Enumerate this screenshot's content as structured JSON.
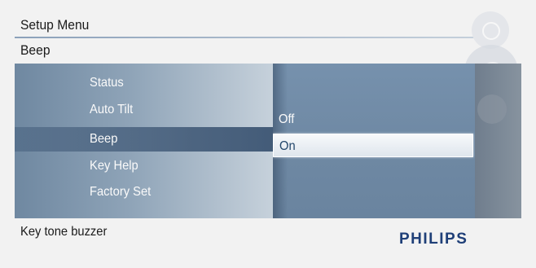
{
  "header": {
    "title": "Setup Menu",
    "breadcrumb": "Beep"
  },
  "menu": {
    "items": [
      {
        "label": "Status",
        "selected": false
      },
      {
        "label": "Auto Tilt",
        "selected": false
      },
      {
        "label": "Beep",
        "selected": true
      },
      {
        "label": "Key Help",
        "selected": false
      },
      {
        "label": "Factory Set",
        "selected": false
      }
    ]
  },
  "options": {
    "items": [
      {
        "label": "Off",
        "selected": false
      },
      {
        "label": "On",
        "selected": true
      }
    ]
  },
  "footer": {
    "description": "Key tone buzzer",
    "brand": "PHILIPS"
  },
  "icons": [
    "joystick-up-icon",
    "joystick-icon",
    "joystick-down-icon"
  ],
  "colors": {
    "accent": "#1f3f78",
    "panel": "#7691ad",
    "selected_option_text": "#23476b"
  }
}
